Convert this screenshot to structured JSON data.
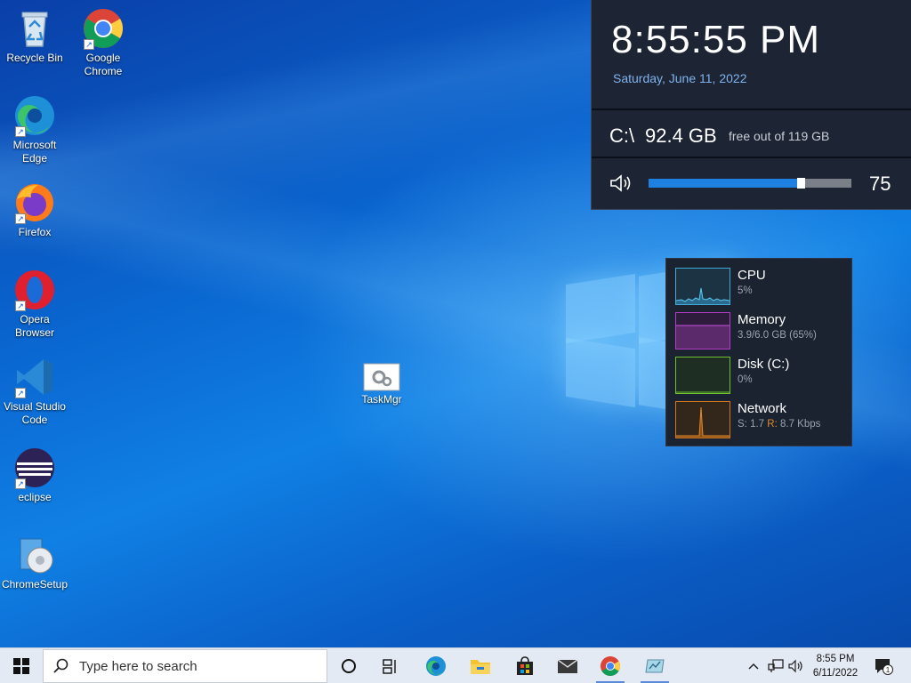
{
  "desktop": {
    "icons": [
      {
        "label": "Recycle Bin",
        "icon": "recycle-bin-icon"
      },
      {
        "label": "Google Chrome",
        "icon": "chrome-icon"
      },
      {
        "label": "Microsoft Edge",
        "icon": "edge-icon"
      },
      {
        "label": "Firefox",
        "icon": "firefox-icon"
      },
      {
        "label": "Opera Browser",
        "icon": "opera-icon"
      },
      {
        "label": "Visual Studio Code",
        "icon": "vscode-icon"
      },
      {
        "label": "eclipse",
        "icon": "eclipse-icon"
      },
      {
        "label": "ChromeSetup",
        "icon": "setup-icon"
      },
      {
        "label": "TaskMgr",
        "icon": "taskmgr-icon"
      }
    ]
  },
  "clock_widget": {
    "time": "8:55:55 PM",
    "date": "Saturday, June 11, 2022",
    "drive": "C:\\",
    "free": "92.4 GB",
    "free_text": "free out of 119 GB",
    "volume": "75",
    "volume_level": 0.75
  },
  "perf_widget": {
    "cpu": {
      "label": "CPU",
      "value": "5%",
      "color": "#3fa9d8"
    },
    "memory": {
      "label": "Memory",
      "value": "3.9/6.0 GB (65%)",
      "color": "#b23cc8"
    },
    "disk": {
      "label": "Disk (C:)",
      "value": "0%",
      "color": "#6cc030"
    },
    "network": {
      "label": "Network",
      "s_label": "S:",
      "s_value": "1.7",
      "r_label": "R:",
      "r_value": "8.7 Kbps",
      "color": "#d0781e"
    }
  },
  "taskbar": {
    "search_placeholder": "Type here to search",
    "clock_time": "8:55 PM",
    "clock_date": "6/11/2022",
    "notification_count": "1",
    "apps": [
      "task-view",
      "edge",
      "file-explorer",
      "store",
      "mail",
      "chrome",
      "taskmgr"
    ]
  },
  "colors": {
    "accent": "#1e80e0",
    "widget_bg": "#1d2433",
    "date_color": "#7fb3ee"
  }
}
